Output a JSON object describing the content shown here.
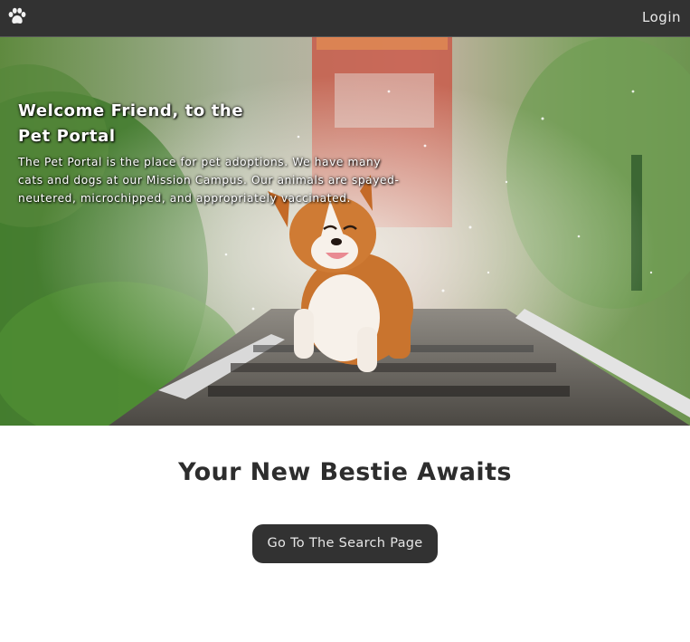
{
  "nav": {
    "logo_icon": "paw-icon",
    "login_label": "Login"
  },
  "hero": {
    "title": "Welcome Friend, to the Pet Portal",
    "description": "The Pet Portal is the place for pet adoptions. We have many cats and dogs at our Mission Campus. Our animals are spayed-neutered, microchipped, and appropriately vaccinated."
  },
  "main": {
    "tagline": "Your New Bestie Awaits",
    "search_button_label": "Go To The Search Page"
  },
  "colors": {
    "navbar": "#323232",
    "button": "#323232",
    "text": "#2d2d2d"
  }
}
